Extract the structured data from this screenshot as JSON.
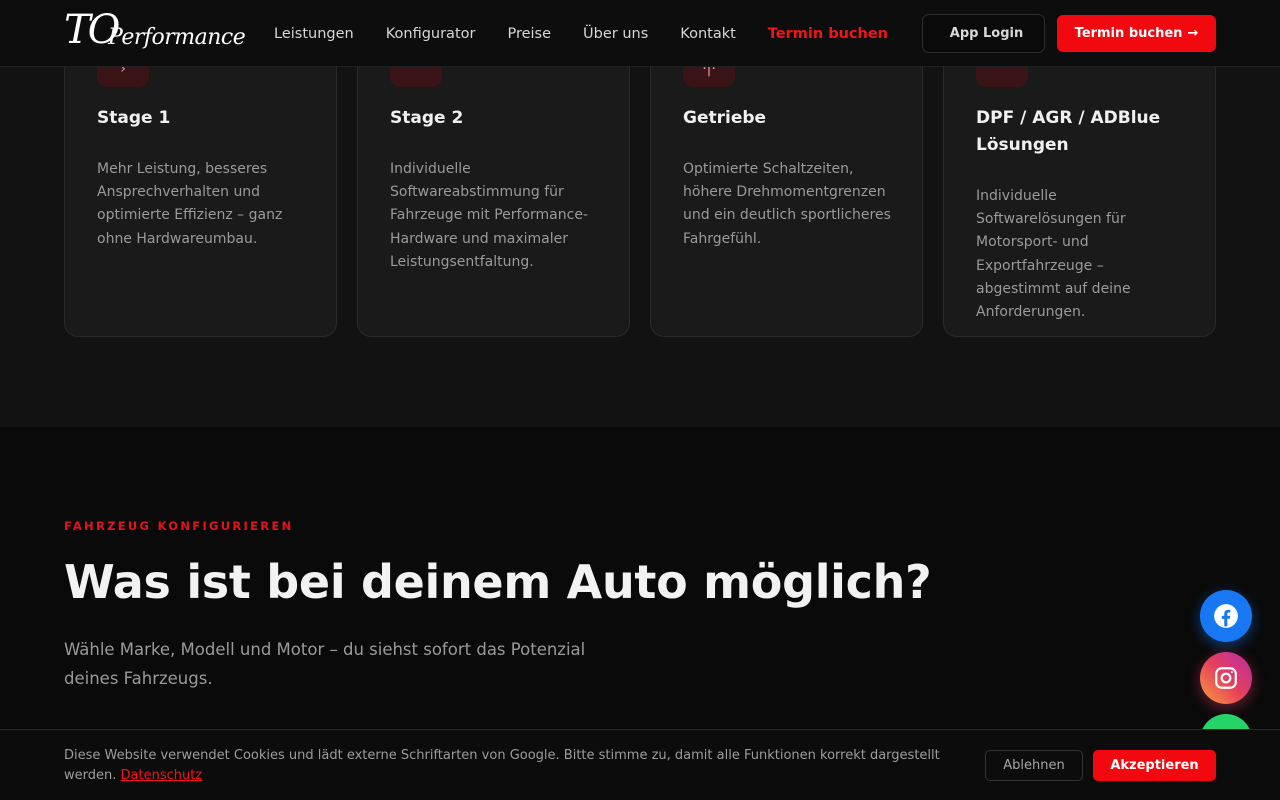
{
  "nav": {
    "logo_main": "TO",
    "logo_sub": "Performance",
    "links": [
      {
        "label": "Leistungen"
      },
      {
        "label": "Konfigurator"
      },
      {
        "label": "Preise"
      },
      {
        "label": "Über uns"
      },
      {
        "label": "Kontakt"
      },
      {
        "label": "Termin buchen"
      }
    ],
    "login_icon": "",
    "login_label": "App Login",
    "book_label": "Termin buchen",
    "book_arrow": "→"
  },
  "services": {
    "cards": [
      {
        "icon_glyph": "›",
        "title": "Stage 1",
        "text": "Mehr Leistung, besseres Ansprechverhalten und optimierte Effizienz – ganz ohne Hardwareumbau."
      },
      {
        "icon_glyph": "",
        "title": "Stage 2",
        "text": "Individuelle Softwareabstimmung für Fahrzeuge mit Performance-Hardware und maximaler Leistungsentfaltung."
      },
      {
        "icon_glyph": "·|·",
        "title": "Getriebe",
        "text": "Optimierte Schaltzeiten, höhere Drehmomentgrenzen und ein deutlich sportlicheres Fahrgefühl."
      },
      {
        "icon_glyph": "",
        "title": "DPF / AGR / ADBlue Lösungen",
        "text": "Individuelle Softwarelösungen für Motorsport- und Exportfahrzeuge – abgestimmt auf deine Anforderungen."
      }
    ]
  },
  "configurator": {
    "eyebrow": "FAHRZEUG KONFIGURIEREN",
    "headline": "Was ist bei deinem Auto möglich?",
    "lead": "Wähle Marke, Modell und Motor – du siehst sofort das Potenzial deines Fahrzeugs."
  },
  "social": {
    "facebook_icon": "facebook-icon",
    "instagram_icon": "instagram-icon",
    "whatsapp_icon": "whatsapp-icon"
  },
  "cookie": {
    "text": "Diese Website verwendet Cookies und lädt externe Schriftarten von Google. Bitte stimme zu, damit alle Funktionen korrekt dargestellt werden.",
    "link_label": "Datenschutz",
    "decline_label": "Ablehnen",
    "accept_label": "Akzeptieren"
  },
  "colors": {
    "accent": "#f2090f",
    "background": "#0b0b0b",
    "card": "#1a1a1a",
    "facebook": "#1877f2",
    "whatsapp": "#25d366"
  }
}
